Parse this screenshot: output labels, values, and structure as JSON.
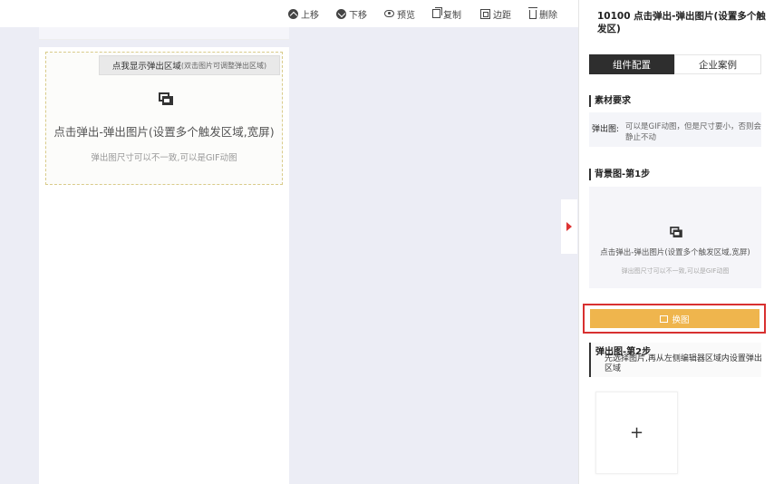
{
  "toolbar": {
    "move_up": "上移",
    "move_down": "下移",
    "preview": "预览",
    "copy": "复制",
    "margin": "边距",
    "delete": "删除"
  },
  "module": {
    "popup_button_main": "点我显示弹出区域",
    "popup_button_hint": "(双击图片可调整弹出区域)",
    "title": "点击弹出-弹出图片(设置多个触发区域,宽屏)",
    "note": "弹出图尺寸可以不一致,可以是GIF动图"
  },
  "panel": {
    "title": "10100 点击弹出-弹出图片(设置多个触发区)",
    "tabs": [
      {
        "label": "组件配置",
        "active": true
      },
      {
        "label": "企业案例",
        "active": false
      }
    ],
    "requirements": {
      "heading": "素材要求",
      "label": "弹出图:",
      "text": "可以是GIF动图，但是尺寸要小，否则会静止不动"
    },
    "background": {
      "heading": "背景图-第1步",
      "title": "点击弹出-弹出图片(设置多个触发区域,宽屏)",
      "note": "弹出图尺寸可以不一致,可以是GIF动图"
    },
    "replace_label": "换图",
    "step2": {
      "heading": "弹出图-第2步",
      "text": "先选择图片,再从左侧编辑器区域内设置弹出区域"
    },
    "upload_symbol": "+"
  },
  "colors": {
    "accent": "#efb54d",
    "highlight": "#d83030",
    "tab_active": "#2e2e2e",
    "canvas_bg": "#ecedf5"
  }
}
